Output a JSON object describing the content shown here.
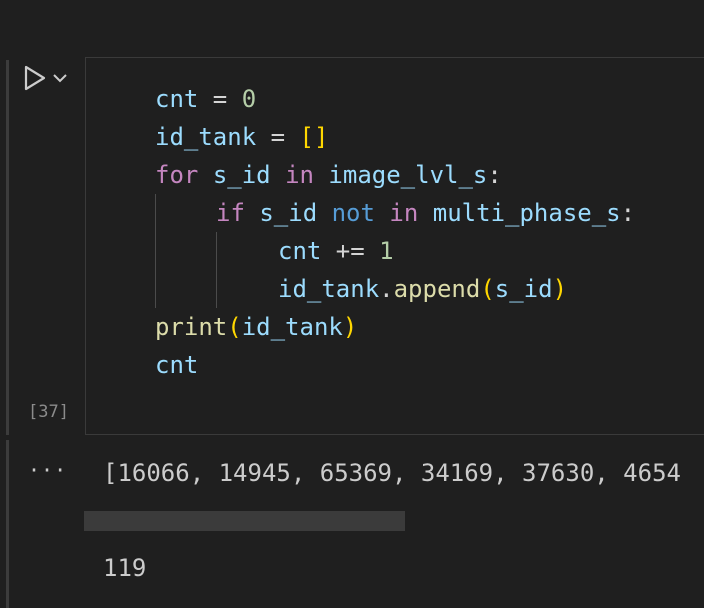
{
  "cell": {
    "execution_count": "[37]",
    "code_lines": [
      {
        "tokens": [
          "cnt",
          " = ",
          "0"
        ]
      },
      {
        "tokens": [
          "id_tank",
          " = ",
          "[]"
        ]
      },
      {
        "tokens": [
          "for",
          " ",
          "s_id",
          " ",
          "in",
          " ",
          "image_lvl_s",
          ":"
        ]
      },
      {
        "tokens": [
          "if",
          " ",
          "s_id",
          " ",
          "not",
          " ",
          "in",
          " ",
          "multi_phase_s",
          ":"
        ]
      },
      {
        "tokens": [
          "cnt",
          " += ",
          "1"
        ]
      },
      {
        "tokens": [
          "id_tank",
          ".",
          "append",
          "(",
          "s_id",
          ")"
        ]
      },
      {
        "tokens": [
          "print",
          "(",
          "id_tank",
          ")"
        ]
      },
      {
        "tokens": [
          "cnt"
        ]
      }
    ]
  },
  "output": {
    "more_label": "···",
    "printed_list": "[16066, 14945, 65369, 34169, 37630, 4654",
    "result": "119"
  },
  "colors": {
    "variable": "#9cdcfe",
    "keyword_control": "#c586c0",
    "keyword_operator": "#569cd6",
    "function": "#dcdcaa",
    "number": "#b5cea8",
    "bracket": "#ffd700",
    "text": "#cccccc",
    "background": "#1f1f1f"
  },
  "icons": [
    "run-icon",
    "chevron-down-icon",
    "more-icon"
  ]
}
